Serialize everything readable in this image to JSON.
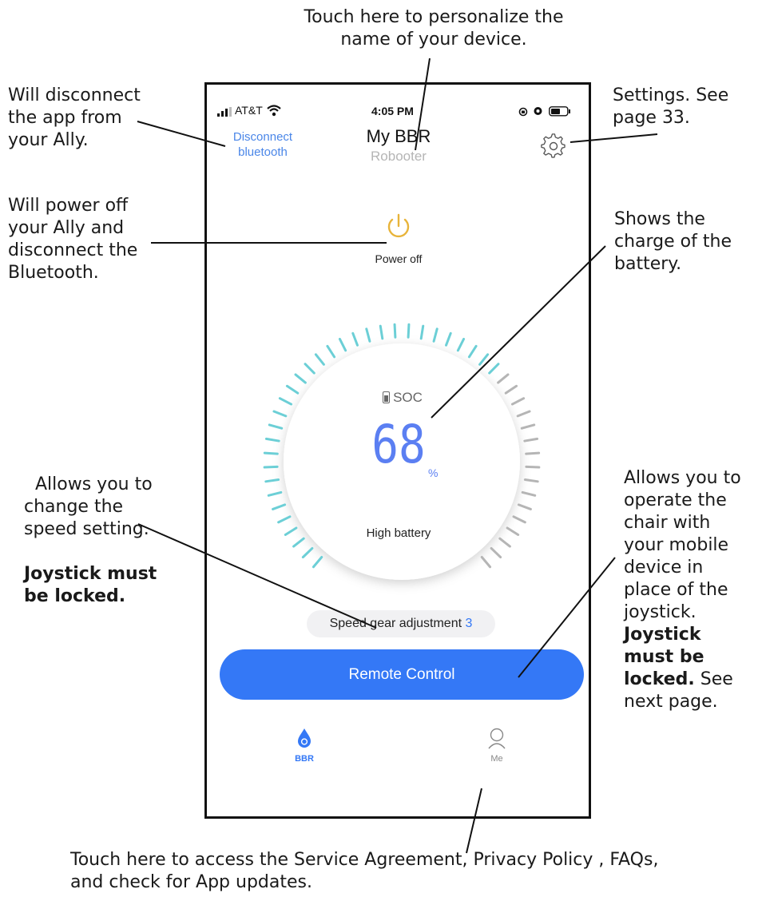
{
  "callouts": {
    "top": "Touch here to personalize the\nname of your device.",
    "disconnect": "Will disconnect\nthe app from\nyour Ally.",
    "settings": "Settings. See\npage 33.",
    "power": "Will power off\nyour Ally and\ndisconnect the\nBluetooth.",
    "battery": "Shows the\ncharge of the\nbattery.",
    "speed_text": "Allows you to\nchange the\nspeed setting.",
    "speed_bold": "Joystick must\nbe locked.",
    "remote_text": "Allows you to\noperate the\nchair with\nyour mobile\ndevice in\nplace of the\njoystick.",
    "remote_bold": "Joystick\nmust be\nlocked.",
    "remote_tail": " See\nnext page.",
    "bottom": "Touch here to access the Service Agreement, Privacy Policy , FAQs,\nand check for App updates."
  },
  "status_bar": {
    "carrier": "AT&T",
    "time": "4:05 PM"
  },
  "header": {
    "disconnect_line1": "Disconnect",
    "disconnect_line2": "bluetooth",
    "device_name": "My BBR",
    "device_model": "Robooter",
    "settings_icon": "gear-icon"
  },
  "power": {
    "label": "Power off",
    "icon": "power-icon"
  },
  "battery": {
    "soc_label": "SOC",
    "value": "68",
    "unit": "%",
    "status": "High battery",
    "level": 0.68
  },
  "speed": {
    "label": "Speed gear adjustment",
    "value": "3"
  },
  "remote": {
    "label": "Remote Control"
  },
  "tabs": [
    {
      "label": "BBR",
      "icon": "drop-icon",
      "active": true
    },
    {
      "label": "Me",
      "icon": "person-icon",
      "active": false
    }
  ],
  "colors": {
    "accent": "#3478f6",
    "teal": "#6ccfd6",
    "power": "#e8b43a",
    "gray_tick": "#b5b5b5",
    "soc_digits": "#5b7ff2"
  }
}
